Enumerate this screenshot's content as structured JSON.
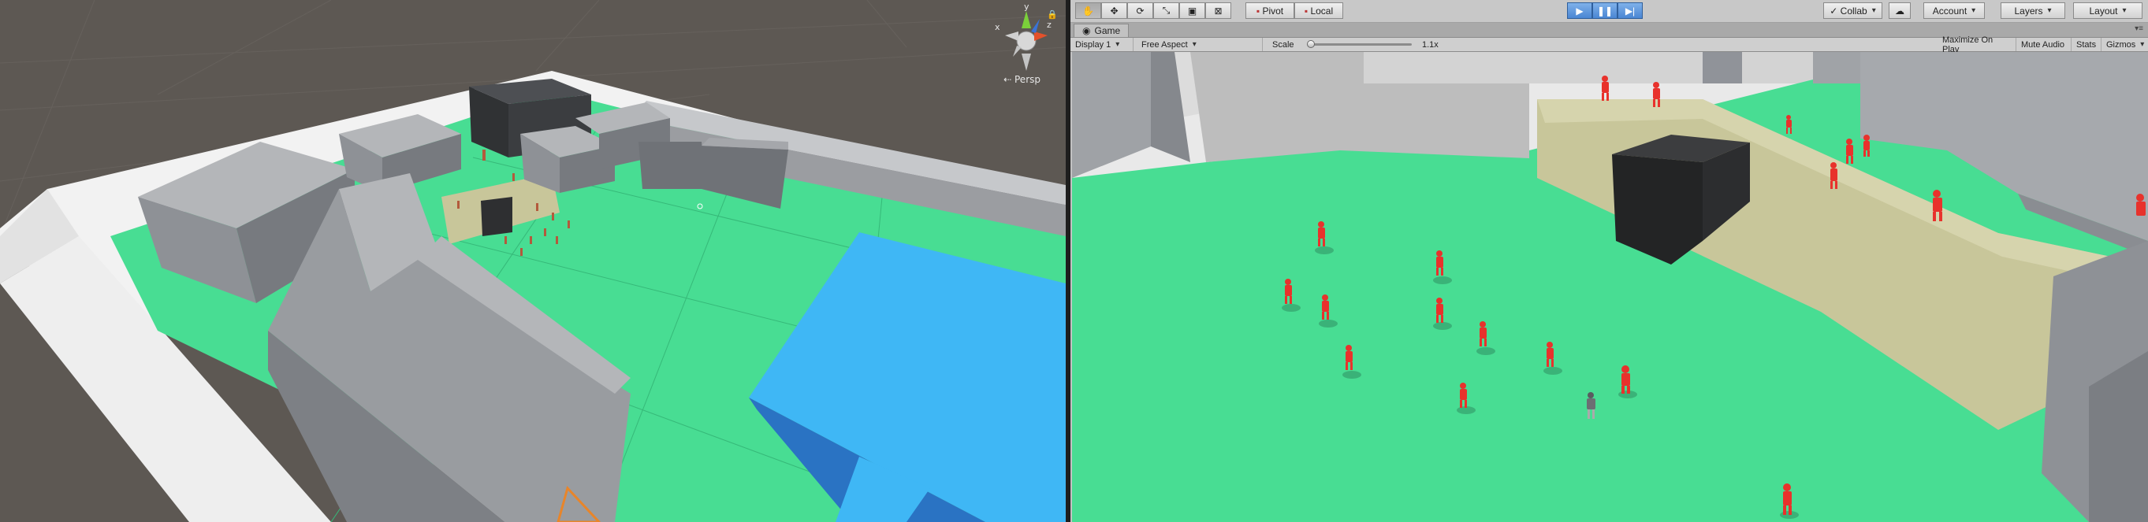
{
  "scene_view": {
    "projection_label": "Persp",
    "gizmo_axes": {
      "y": "y",
      "x": "x",
      "z": "z"
    }
  },
  "toolbar": {
    "tools": [
      "hand-tool",
      "move-tool",
      "rotate-tool",
      "scale-tool",
      "rect-tool",
      "transform-tool"
    ],
    "pivot_label": "Pivot",
    "local_label": "Local",
    "collab_label": "Collab",
    "account_label": "Account",
    "layers_label": "Layers",
    "layout_label": "Layout"
  },
  "game_tab": {
    "title": "Game"
  },
  "game_bar": {
    "display": "Display 1",
    "aspect": "Free Aspect",
    "scale_label": "Scale",
    "scale_value": "1.1x",
    "maximize_on_play": "Maximize On Play",
    "mute_audio": "Mute Audio",
    "stats": "Stats",
    "gizmos": "Gizmos"
  },
  "colors": {
    "ground_green": "#48dd93",
    "water_blue": "#3fb7f5",
    "building_gray": "#8e9196",
    "enemy_red": "#e8322c",
    "play_blue": "#4a86d3"
  }
}
